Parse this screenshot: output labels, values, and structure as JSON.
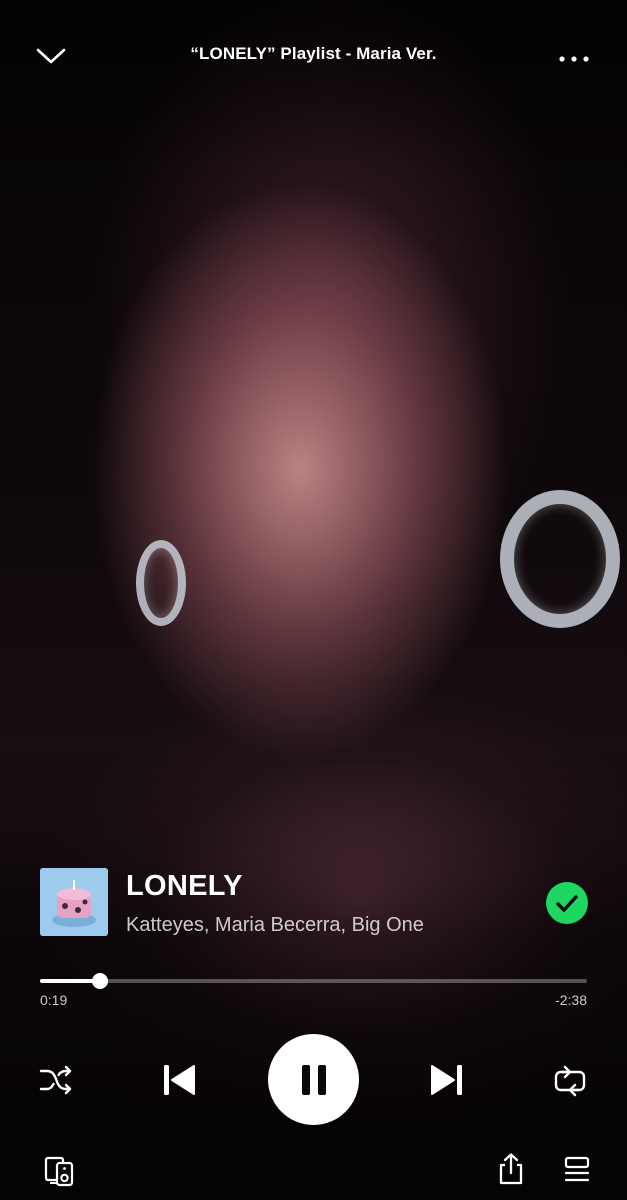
{
  "header": {
    "title": "“LONELY” Playlist - Maria Ver.",
    "collapse_icon": "chevron-down-icon",
    "more_icon": "more-horizontal-icon"
  },
  "track": {
    "title": "LONELY",
    "artists": "Katteyes, Maria Becerra, Big One",
    "cover_icon": "album-cover",
    "liked": true,
    "liked_color": "#1ed760"
  },
  "playback": {
    "elapsed": "0:19",
    "remaining": "-2:38",
    "progress_fraction": 0.11,
    "state": "playing"
  },
  "controls": {
    "shuffle_icon": "shuffle-icon",
    "previous_icon": "skip-previous-icon",
    "pause_icon": "pause-icon",
    "next_icon": "skip-next-icon",
    "repeat_icon": "repeat-icon"
  },
  "footer": {
    "devices_icon": "connect-device-icon",
    "share_icon": "share-icon",
    "queue_icon": "queue-icon"
  },
  "colors": {
    "accent": "#1ed760",
    "text": "#ffffff"
  }
}
